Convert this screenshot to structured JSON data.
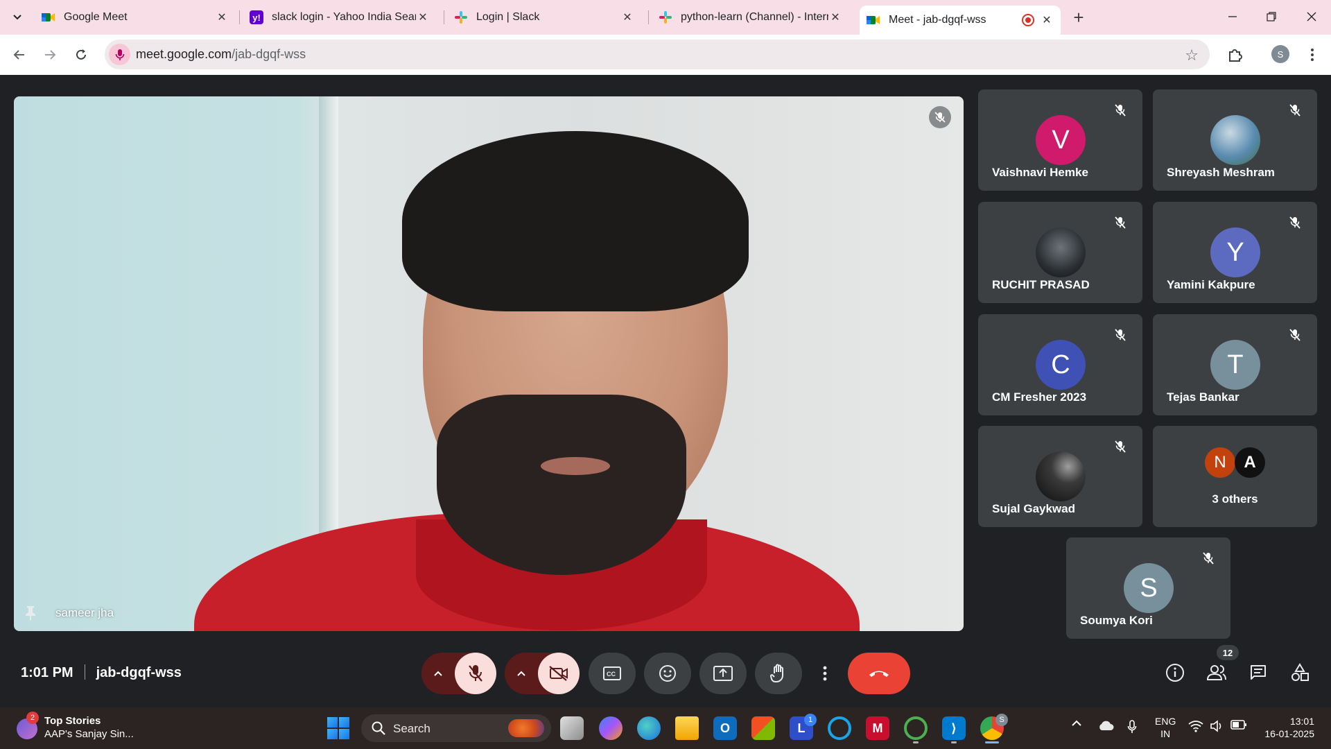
{
  "browser": {
    "tabs": [
      {
        "title": "Google Meet",
        "favicon": "google-meet-icon"
      },
      {
        "title": "slack login - Yahoo India Search",
        "favicon": "yahoo-icon"
      },
      {
        "title": "Login | Slack",
        "favicon": "slack-icon"
      },
      {
        "title": "python-learn (Channel) - Intern",
        "favicon": "slack-icon"
      },
      {
        "title": "Meet - jab-dgqf-wss",
        "favicon": "google-meet-icon",
        "active": true,
        "recording": true
      }
    ],
    "url_host": "meet.google.com",
    "url_path": "/jab-dgqf-wss",
    "profile_initial": "S"
  },
  "meeting": {
    "main_speaker": "sameer jha",
    "time": "1:01 PM",
    "code": "jab-dgqf-wss",
    "participants_count": "12"
  },
  "tiles": [
    {
      "name": "Vaishnavi Hemke",
      "initial": "V",
      "color": "#d01a6b",
      "muted": true
    },
    {
      "name": "Shreyash Meshram",
      "initial": "",
      "color": "#5a8bb0",
      "photo": true,
      "muted": true
    },
    {
      "name": "RUCHIT PRASAD",
      "initial": "",
      "color": "#2b2f33",
      "photo": true,
      "muted": true
    },
    {
      "name": "Yamini Kakpure",
      "initial": "Y",
      "color": "#5c6bc0",
      "muted": true
    },
    {
      "name": "CM Fresher 2023",
      "initial": "C",
      "color": "#3f51b5",
      "muted": true
    },
    {
      "name": "Tejas Bankar",
      "initial": "T",
      "color": "#78909c",
      "muted": true
    },
    {
      "name": "Sujal Gaykwad",
      "initial": "",
      "color": "#1a1a1a",
      "photo": true,
      "muted": true
    },
    {
      "name": "Soumya Kori",
      "initial": "S",
      "color": "#78909c",
      "muted": true
    }
  ],
  "others": {
    "label": "3 others",
    "avatar1_initial": "N",
    "avatar1_color": "#c2410c",
    "avatar2_initial": "A",
    "avatar2_color": "#111111"
  },
  "taskbar": {
    "news_badge": "2",
    "news_title": "Top Stories",
    "news_subtitle": "AAP's Sanjay Sin...",
    "search_label": "Search",
    "lang_line1": "ENG",
    "lang_line2": "IN",
    "time": "13:01",
    "date": "16-01-2025",
    "chrome_badge": "S",
    "app_badge": "1"
  },
  "colors": {
    "meet_background": "#202124",
    "tile_background": "#3c4043",
    "end_call": "#ea4335",
    "control_active": "#f9dedc",
    "tabstrip": "#f8dfe7"
  }
}
